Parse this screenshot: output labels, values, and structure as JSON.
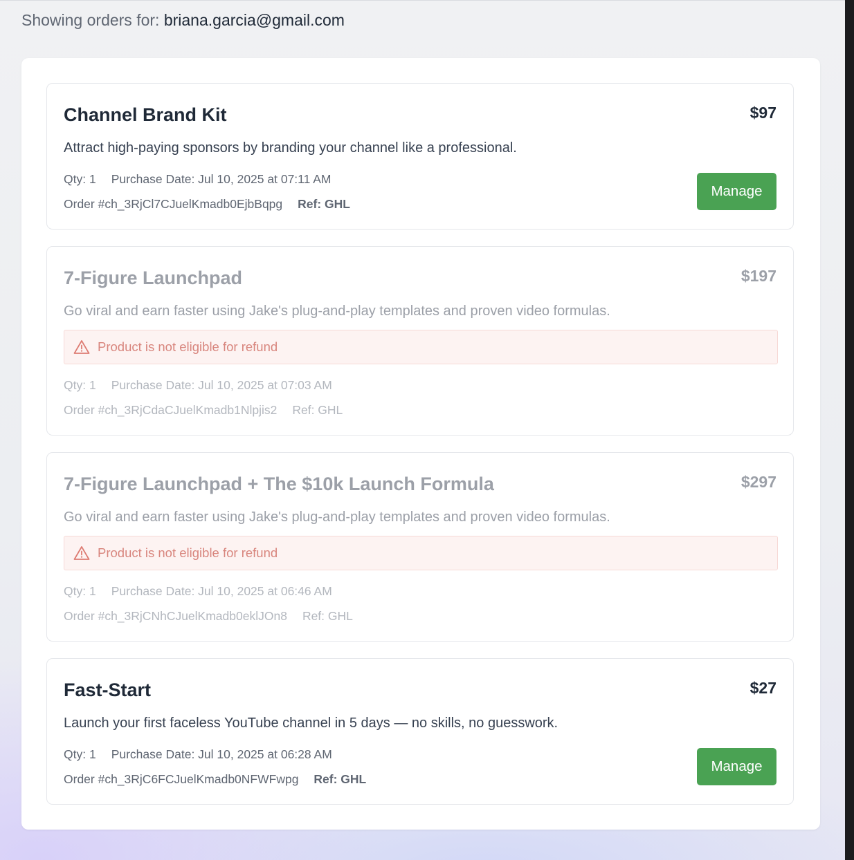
{
  "header": {
    "prefix": "Showing orders for: ",
    "email": "briana.garcia@gmail.com"
  },
  "orders": [
    {
      "title": "Channel Brand Kit",
      "price": "$97",
      "description": "Attract high-paying sponsors by branding your channel like a professional.",
      "qty": "Qty: 1",
      "purchase_date": "Purchase Date: Jul 10, 2025 at 07:11 AM",
      "order_id": "Order #ch_3RjCl7CJuelKmadb0EjbBqpg",
      "ref": "Ref: GHL",
      "manage_label": "Manage",
      "eligible": true
    },
    {
      "title": "7-Figure Launchpad",
      "price": "$197",
      "description": "Go viral and earn faster using Jake's plug-and-play templates and proven video formulas.",
      "alert": "Product is not eligible for refund",
      "qty": "Qty: 1",
      "purchase_date": "Purchase Date: Jul 10, 2025 at 07:03 AM",
      "order_id": "Order #ch_3RjCdaCJuelKmadb1Nlpjis2",
      "ref": "Ref: GHL",
      "eligible": false
    },
    {
      "title": "7-Figure Launchpad + The $10k Launch Formula",
      "price": "$297",
      "description": "Go viral and earn faster using Jake's plug-and-play templates and proven video formulas.",
      "alert": "Product is not eligible for refund",
      "qty": "Qty: 1",
      "purchase_date": "Purchase Date: Jul 10, 2025 at 06:46 AM",
      "order_id": "Order #ch_3RjCNhCJuelKmadb0eklJOn8",
      "ref": "Ref: GHL",
      "eligible": false
    },
    {
      "title": "Fast-Start",
      "price": "$27",
      "description": "Launch your first faceless YouTube channel in 5 days — no skills, no guesswork.",
      "qty": "Qty: 1",
      "purchase_date": "Purchase Date: Jul 10, 2025 at 06:28 AM",
      "order_id": "Order #ch_3RjC6FCJuelKmadb0NFWFwpg",
      "ref": "Ref: GHL",
      "manage_label": "Manage",
      "eligible": true
    }
  ],
  "colors": {
    "manage_button": "#4aa253",
    "alert_text": "#d8857d",
    "alert_background": "#fdf3f2"
  },
  "icons": {
    "alert": "warning-triangle-icon"
  }
}
